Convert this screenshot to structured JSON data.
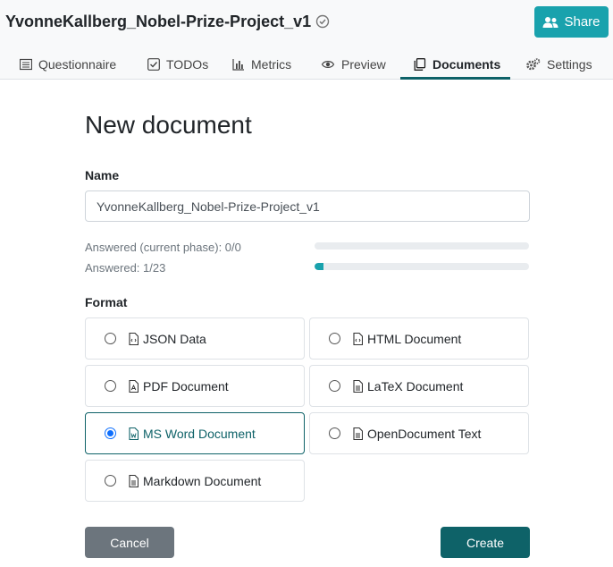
{
  "header": {
    "project_title": "YvonneKallberg_Nobel-Prize-Project_v1",
    "share_label": "Share"
  },
  "tabs": [
    {
      "label": "Questionnaire",
      "icon": "list-icon"
    },
    {
      "label": "TODOs",
      "icon": "checkbox-icon"
    },
    {
      "label": "Metrics",
      "icon": "bar-chart-icon"
    },
    {
      "label": "Preview",
      "icon": "eye-icon"
    },
    {
      "label": "Documents",
      "icon": "copy-icon",
      "active": true
    },
    {
      "label": "Settings",
      "icon": "cogs-icon"
    }
  ],
  "form": {
    "heading": "New document",
    "name_label": "Name",
    "name_value": "YvonneKallberg_Nobel-Prize-Project_v1",
    "answered_current_label": "Answered (current phase): 0/0",
    "answered_current_fraction": 0,
    "answered_label": "Answered: 1/23",
    "answered_fraction": 0.0435,
    "format_label": "Format",
    "formats": [
      {
        "label": "JSON Data",
        "icon": "file-code-icon",
        "selected": false
      },
      {
        "label": "HTML Document",
        "icon": "file-code-icon",
        "selected": false
      },
      {
        "label": "PDF Document",
        "icon": "file-pdf-icon",
        "selected": false
      },
      {
        "label": "LaTeX Document",
        "icon": "file-text-icon",
        "selected": false
      },
      {
        "label": "MS Word Document",
        "icon": "file-word-icon",
        "selected": true
      },
      {
        "label": "OpenDocument Text",
        "icon": "file-text-icon",
        "selected": false
      },
      {
        "label": "Markdown Document",
        "icon": "file-text-icon",
        "selected": false
      }
    ],
    "cancel_label": "Cancel",
    "create_label": "Create"
  },
  "colors": {
    "accent": "#19a2ad",
    "primary_dark": "#0e6268",
    "secondary": "#6c757d"
  }
}
